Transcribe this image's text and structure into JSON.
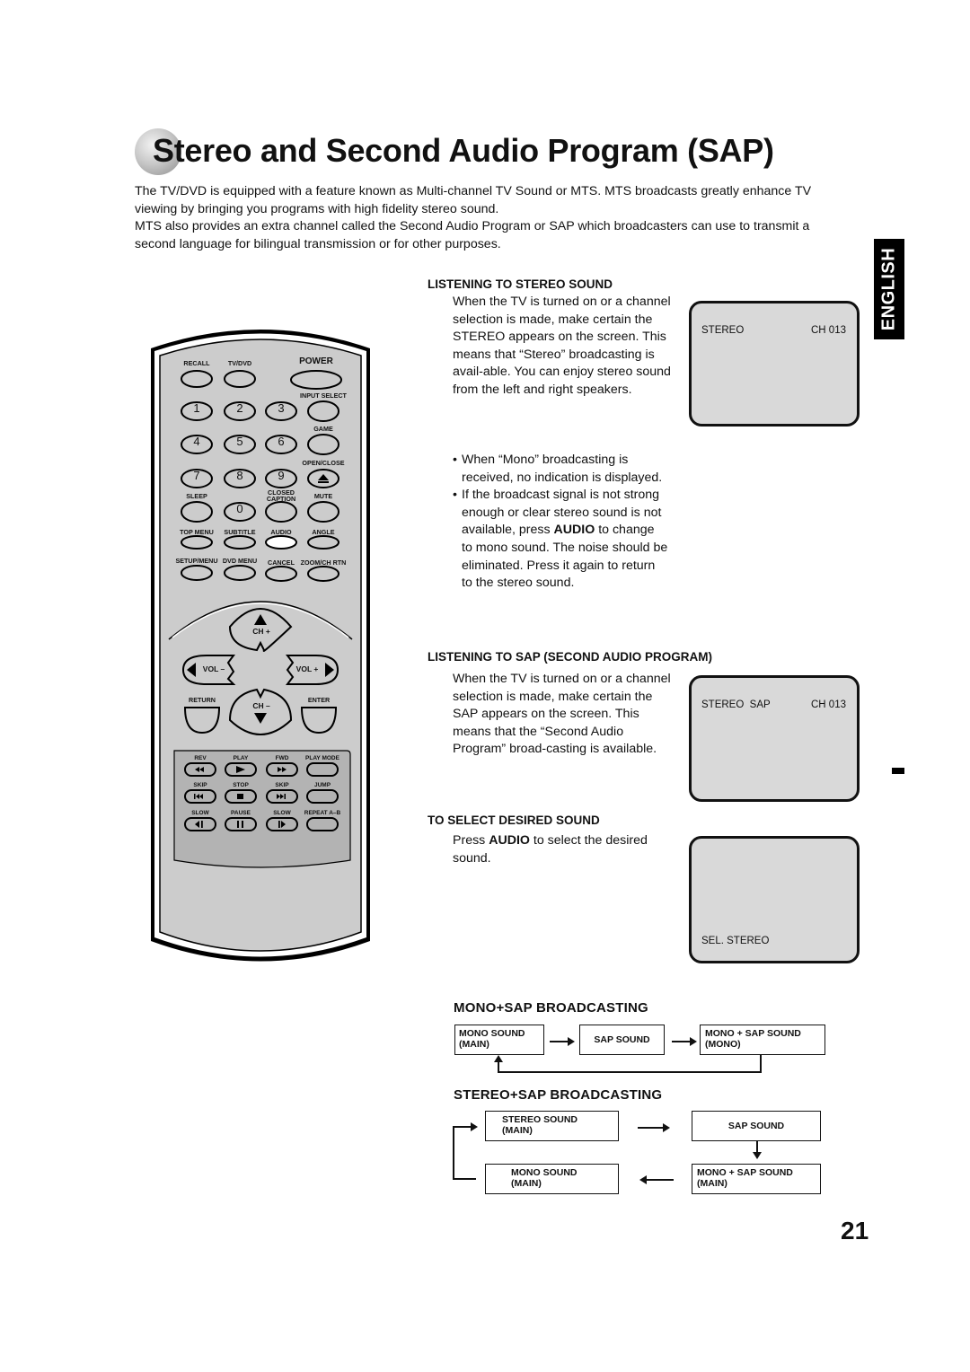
{
  "page": {
    "title": "Stereo and Second Audio Program (SAP)",
    "intro": [
      "The TV/DVD is equipped with a feature known as Multi-channel TV Sound or MTS. MTS broadcasts greatly enhance TV viewing by bringing you programs with high fidelity stereo sound.",
      "MTS also provides an extra channel called the Second Audio Program or SAP which broadcasters can use to transmit a second language for bilingual transmission or for other purposes."
    ],
    "language_tab": "ENGLISH",
    "page_number": "21"
  },
  "sections": {
    "stereo": {
      "heading": "LISTENING TO STEREO SOUND",
      "body": "When the TV is turned on or a channel selection is made, make certain the STEREO appears on the screen. This means that “Stereo” broadcasting is avail-able. You can enjoy stereo sound from the left and right speakers.",
      "bullets": [
        {
          "pre": "When “Mono” broadcasting is received, no indication is displayed.",
          "bold": "",
          "post": ""
        },
        {
          "pre": "If the broadcast signal is not strong enough or clear stereo sound is not available, press ",
          "bold": "AUDIO",
          "post": " to change to mono sound. The noise should be eliminated. Press it again to return to the stereo sound."
        }
      ],
      "screen": {
        "left": "STEREO",
        "right": "CH 013"
      }
    },
    "sap": {
      "heading": "LISTENING TO SAP (SECOND AUDIO PROGRAM)",
      "body": "When the TV is turned on or a channel selection is made, make certain the SAP appears on the screen. This means that the “Second Audio Program” broad-casting is available.",
      "screen": {
        "left": "STEREO  SAP",
        "right": "CH 013"
      }
    },
    "select": {
      "heading": "TO SELECT DESIRED SOUND",
      "body_pre": "Press ",
      "body_bold": "AUDIO",
      "body_post": " to select the desired sound.",
      "screen": {
        "bottom_left": "SEL. STEREO"
      }
    }
  },
  "mono_sap": {
    "heading": "MONO+SAP BROADCASTING",
    "boxes": [
      {
        "line1": "MONO SOUND",
        "line2": "(MAIN)"
      },
      {
        "line1": "SAP SOUND",
        "line2": ""
      },
      {
        "line1": "MONO + SAP SOUND",
        "line2": "(MONO)"
      }
    ]
  },
  "stereo_sap": {
    "heading": "STEREO+SAP BROADCASTING",
    "boxes": [
      {
        "line1": "STEREO SOUND",
        "line2": "(MAIN)"
      },
      {
        "line1": "SAP SOUND",
        "line2": ""
      },
      {
        "line1": "MONO + SAP SOUND",
        "line2": "(MAIN)"
      },
      {
        "line1": "MONO SOUND",
        "line2": "(MAIN)"
      }
    ]
  },
  "remote": {
    "labels": {
      "recall": "RECALL",
      "tvdvd": "TV/DVD",
      "power": "POWER",
      "input_select": "INPUT SELECT",
      "game": "GAME",
      "open_close": "OPEN/CLOSE",
      "sleep": "SLEEP",
      "closed_caption_1": "CLOSED",
      "closed_caption_2": "CAPTION",
      "mute": "MUTE",
      "top_menu": "TOP MENU",
      "subtitle": "SUBTITLE",
      "audio": "AUDIO",
      "angle": "ANGLE",
      "setup_menu": "SETUP/MENU",
      "dvd_menu": "DVD MENU",
      "cancel": "CANCEL",
      "zoom_ch_rtn": "ZOOM/CH RTN",
      "ch_plus": "CH +",
      "ch_minus": "CH –",
      "vol_minus": "VOL –",
      "vol_plus": "VOL +",
      "return": "RETURN",
      "enter": "ENTER",
      "rev": "REV",
      "play": "PLAY",
      "fwd": "FWD",
      "play_mode": "PLAY MODE",
      "skip_back": "SKIP",
      "stop": "STOP",
      "skip_fwd": "SKIP",
      "jump": "JUMP",
      "slow_back": "SLOW",
      "pause": "PAUSE",
      "slow_fwd": "SLOW",
      "repeat_ab": "REPEAT A–B"
    },
    "digits": [
      "1",
      "2",
      "3",
      "4",
      "5",
      "6",
      "7",
      "8",
      "9",
      "0"
    ],
    "highlight_color": "#ffffff",
    "body_color": "#cccccc",
    "transport_panel_color": "#b3b3b3"
  }
}
